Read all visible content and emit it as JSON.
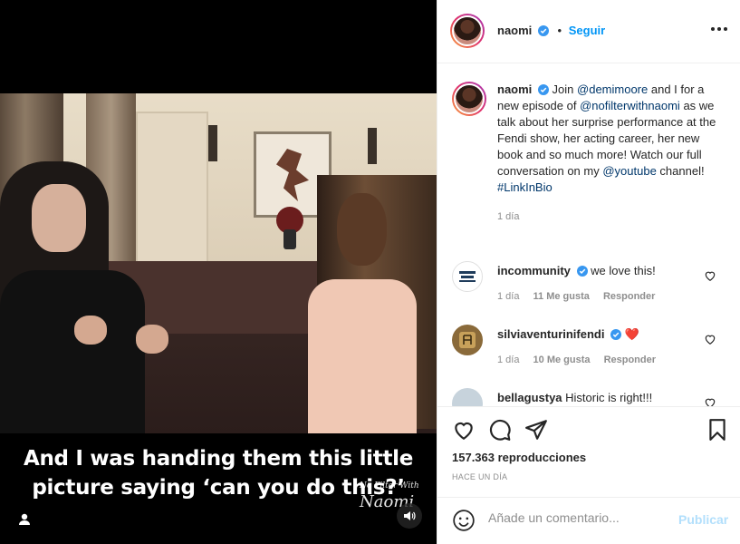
{
  "video": {
    "caption_line1": "And I was handing them this little",
    "caption_line2": "picture saying ‘can you do this?’",
    "watermark_small": "No Filter With",
    "watermark_big": "Naomi",
    "user_tag_icon": "person-icon",
    "sound_icon": "speaker-icon"
  },
  "header": {
    "username": "naomi",
    "follow_label": "Seguir",
    "separator": "•"
  },
  "post": {
    "username": "naomi",
    "text_parts": {
      "a": "Join ",
      "mention1": "@demimoore",
      "b": " and I for a new episode of ",
      "mention2": "@nofilterwithnaomi",
      "c": " as we talk about her surprise performance at the Fendi show, her acting career, her new book and so much more! Watch our full conversation on my ",
      "mention3": "@youtube",
      "d": " channel! ",
      "hashtag": "#LinkInBio"
    },
    "time": "1 día"
  },
  "comments": [
    {
      "username": "incommunity",
      "text": "we love this!",
      "time": "1 día",
      "likes": "11 Me gusta",
      "reply": "Responder"
    },
    {
      "username": "silviaventurinifendi",
      "text": "❤️",
      "time": "1 día",
      "likes": "10 Me gusta",
      "reply": "Responder"
    },
    {
      "username": "bellagustya",
      "text": "Historic is right!!!"
    }
  ],
  "stats": {
    "views": "157.363 reproducciones",
    "posted": "HACE UN DÍA"
  },
  "composer": {
    "placeholder": "Añade un comentario...",
    "publish_label": "Publicar"
  },
  "colors": {
    "accent": "#0095f6",
    "link": "#00376b",
    "muted": "#8e8e8e",
    "publish_disabled": "#b2dffc",
    "heart_red": "#ed4956"
  }
}
